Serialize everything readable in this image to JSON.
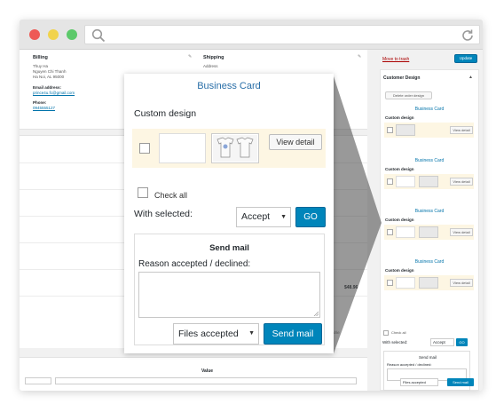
{
  "browser": {
    "window_controls": [
      "close",
      "minimize",
      "maximize"
    ],
    "address": "",
    "icons": {
      "search": "search-icon",
      "reload": "reload-icon"
    }
  },
  "order": {
    "billing": {
      "title": "Billing",
      "name": "Thuy Ha",
      "street": "Nguyen Chi Thanh",
      "city": "Ha Noi, AL 95000",
      "email_label": "Email address:",
      "email": "prince4u.fc@gmail.com",
      "phone_label": "Phone:",
      "phone": "0945555127"
    },
    "shipping": {
      "title": "Shipping",
      "address_label": "Address"
    },
    "total": "$48.96",
    "editable_note": "ger editable.",
    "value_header": "Value"
  },
  "sidebar": {
    "trash_link": "Move to trash",
    "update_button": "Update",
    "customer_design_title": "Customer Design",
    "delete_order_design": "Delete order design",
    "groups": [
      {
        "title": "Business Card",
        "label": "Custom design",
        "view": "View detail"
      },
      {
        "title": "Business Card",
        "label": "Custom design",
        "view": "View detail"
      },
      {
        "title": "Business Card",
        "label": "Custom design",
        "view": "View detail"
      },
      {
        "title": "Business Card",
        "label": "Custom design",
        "view": "View detail"
      }
    ],
    "check_all": "Check all",
    "with_selected": "With selected:",
    "accept": "Accept",
    "go": "GO",
    "send_mail_title": "Send mail",
    "reason_label": "Reason accepted / declined:",
    "files_accepted": "Files accepted",
    "send_mail_button": "Send mail"
  },
  "modal": {
    "title": "Business Card",
    "custom_design_label": "Custom design",
    "view_detail": "View detail",
    "check_all": "Check all",
    "with_selected": "With selected:",
    "action_select": "Accept",
    "go_button": "GO",
    "send_mail_title": "Send mail",
    "reason_label": "Reason accepted / declined:",
    "files_select": "Files accepted",
    "send_mail_button": "Send mail"
  },
  "colors": {
    "primary_button": "#0085ba",
    "link": "#0073aa",
    "title_blue": "#2a6fa8",
    "highlight_row": "#fdf6e3",
    "trash_red": "#a00"
  }
}
